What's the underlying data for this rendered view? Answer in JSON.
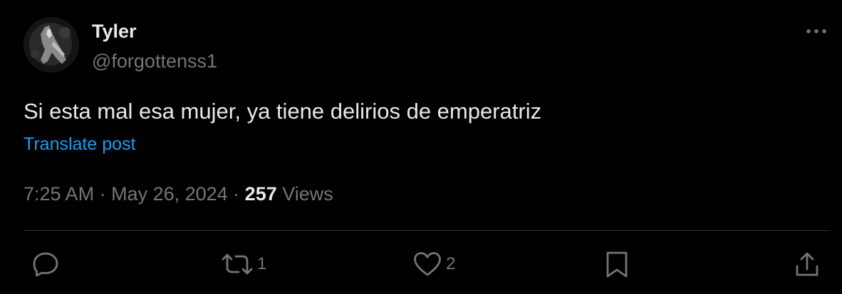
{
  "author": {
    "display_name": "Tyler",
    "handle": "@forgottenss1"
  },
  "post": {
    "text": "Si esta mal esa mujer, ya tiene delirios de emperatriz",
    "translate_label": "Translate post"
  },
  "meta": {
    "time": "7:25 AM",
    "separator": " · ",
    "date": "May 26, 2024",
    "views_count": "257",
    "views_label": " Views"
  },
  "actions": {
    "reply_count": "",
    "repost_count": "1",
    "like_count": "2"
  },
  "icons": {
    "more": "more-dots-icon",
    "reply": "reply-icon",
    "repost": "repost-icon",
    "like": "heart-icon",
    "bookmark": "bookmark-icon",
    "share": "share-icon"
  },
  "colors": {
    "background": "#000000",
    "text_primary": "#e7e9ea",
    "text_secondary": "#71767b",
    "link": "#1d9bf0",
    "divider": "#2f3336"
  }
}
